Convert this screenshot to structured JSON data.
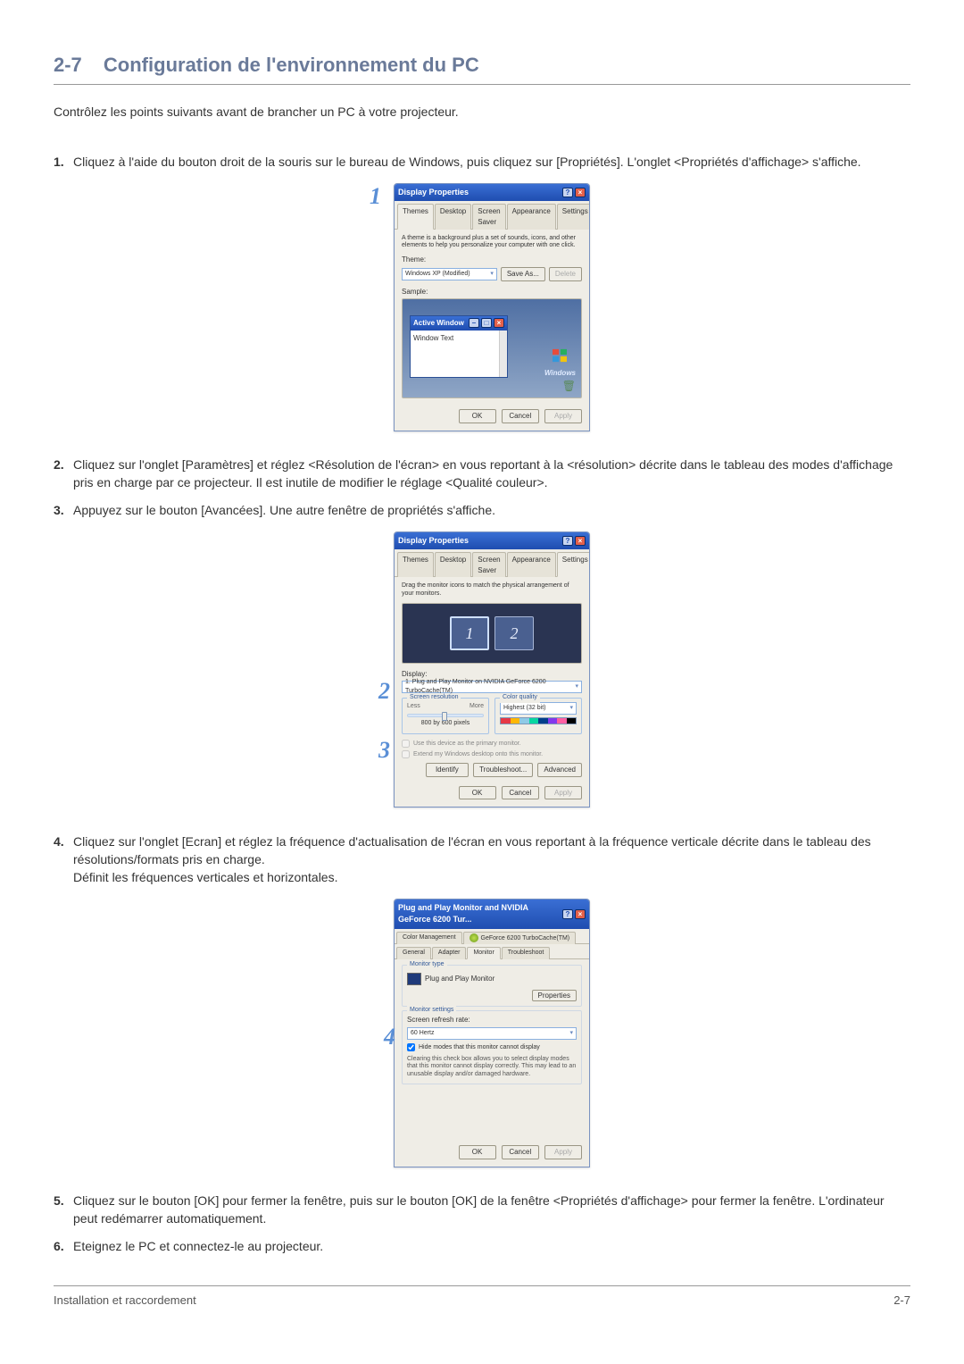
{
  "heading": {
    "num": "2-7",
    "title": "Configuration de l'environnement du PC"
  },
  "intro": "Contrôlez les points suivants avant de brancher un PC à votre projecteur.",
  "steps": {
    "s1": "Cliquez à l'aide du bouton droit de la souris sur le bureau de Windows, puis cliquez sur [Propriétés]. L'onglet <Propriétés d'affichage> s'affiche.",
    "s2": "Cliquez sur l'onglet [Paramètres] et réglez <Résolution de l'écran> en vous reportant à la <résolution> décrite dans le tableau des modes d'affichage pris en charge par ce projecteur. Il est inutile de modifier le réglage <Qualité couleur>.",
    "s3": "Appuyez sur le bouton [Avancées]. Une autre fenêtre de propriétés s'affiche.",
    "s4": "Cliquez sur l'onglet [Ecran] et réglez la fréquence d'actualisation de l'écran en vous reportant à la fréquence verticale décrite dans le tableau des résolutions/formats pris en charge.",
    "s4b": "Définit les fréquences verticales et horizontales.",
    "s5": "Cliquez sur le bouton [OK] pour fermer la fenêtre, puis sur le bouton [OK] de la fenêtre <Propriétés d'affichage> pour fermer la fenêtre. L'ordinateur peut redémarrer automatiquement.",
    "s6": "Eteignez le PC et connectez-le au projecteur."
  },
  "dlg1": {
    "title": "Display Properties",
    "tabs": [
      "Themes",
      "Desktop",
      "Screen Saver",
      "Appearance",
      "Settings"
    ],
    "desc": "A theme is a background plus a set of sounds, icons, and other elements to help you personalize your computer with one click.",
    "theme_label": "Theme:",
    "theme_value": "Windows XP (Modified)",
    "save_as": "Save As...",
    "delete": "Delete",
    "sample_label": "Sample:",
    "active_window": "Active Window",
    "window_text": "Window Text",
    "windows": "Windows",
    "ok": "OK",
    "cancel": "Cancel",
    "apply": "Apply"
  },
  "dlg2": {
    "title": "Display Properties",
    "tabs": [
      "Themes",
      "Desktop",
      "Screen Saver",
      "Appearance",
      "Settings"
    ],
    "desc": "Drag the monitor icons to match the physical arrangement of your monitors.",
    "mon1": "1",
    "mon2": "2",
    "display_label": "Display:",
    "display_value": "1. Plug and Play Monitor on NVIDIA GeForce 6200 TurboCache(TM)",
    "res_label": "Screen resolution",
    "less": "Less",
    "more": "More",
    "res_value": "800 by 600 pixels",
    "color_label": "Color quality",
    "color_value": "Highest (32 bit)",
    "chk1": "Use this device as the primary monitor.",
    "chk2": "Extend my Windows desktop onto this monitor.",
    "identify": "Identify",
    "troubleshoot": "Troubleshoot...",
    "advanced": "Advanced",
    "ok": "OK",
    "cancel": "Cancel",
    "apply": "Apply"
  },
  "dlg3": {
    "title": "Plug and Play Monitor and NVIDIA GeForce 6200 Tur...",
    "tabs_top": [
      "Color Management",
      "GeForce 6200 TurboCache(TM)"
    ],
    "tabs_bot": [
      "General",
      "Adapter",
      "Monitor",
      "Troubleshoot"
    ],
    "mtype_label": "Monitor type",
    "mtype_value": "Plug and Play Monitor",
    "properties": "Properties",
    "msettings_label": "Monitor settings",
    "refresh_label": "Screen refresh rate:",
    "refresh_value": "60 Hertz",
    "hide": "Hide modes that this monitor cannot display",
    "hide_desc": "Clearing this check box allows you to select display modes that this monitor cannot display correctly. This may lead to an unusable display and/or damaged hardware.",
    "ok": "OK",
    "cancel": "Cancel",
    "apply": "Apply"
  },
  "footer": {
    "left": "Installation et raccordement",
    "right": "2-7"
  }
}
